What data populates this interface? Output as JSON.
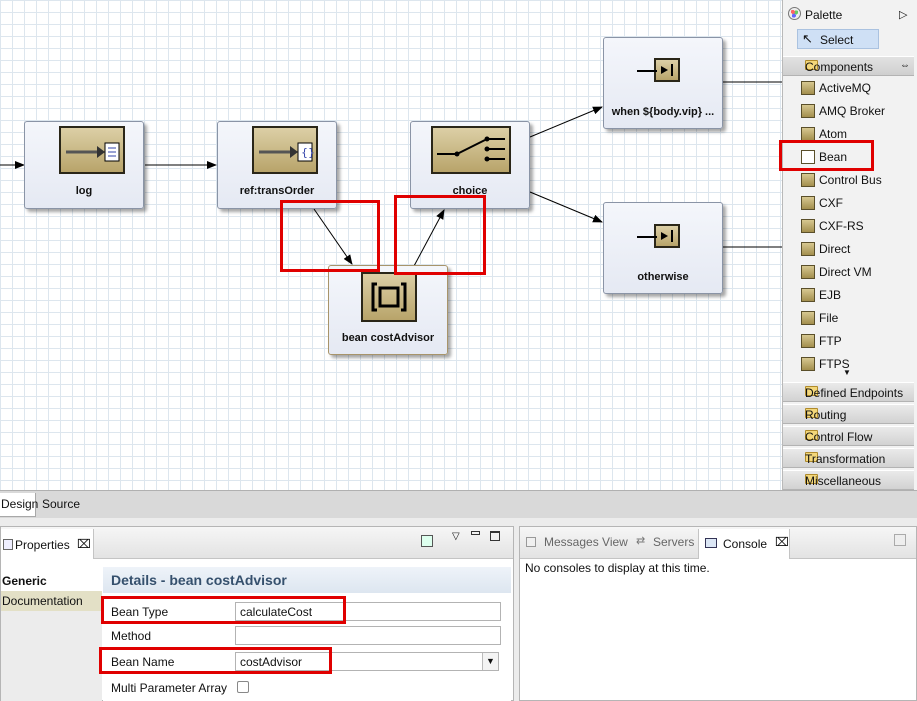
{
  "canvas": {
    "nodes": [
      {
        "id": "log",
        "label": "log"
      },
      {
        "id": "transorder",
        "label": "ref:transOrder"
      },
      {
        "id": "choice",
        "label": "choice"
      },
      {
        "id": "when",
        "label": "when ${body.vip} ..."
      },
      {
        "id": "otherwise",
        "label": "otherwise"
      },
      {
        "id": "bean",
        "label": "bean costAdvisor"
      }
    ]
  },
  "palette": {
    "title": "Palette",
    "select_label": "Select",
    "components_drawer": "Components",
    "items": [
      "ActiveMQ",
      "AMQ Broker",
      "Atom",
      "Bean",
      "Control Bus",
      "CXF",
      "CXF-RS",
      "Direct",
      "Direct VM",
      "EJB",
      "File",
      "FTP",
      "FTPS"
    ],
    "drawers": [
      "Defined Endpoints",
      "Routing",
      "Control Flow",
      "Transformation",
      "Miscellaneous"
    ]
  },
  "editor_tabs": [
    "Design",
    "Source"
  ],
  "properties": {
    "tab_label": "Properties",
    "side_tabs": [
      "Generic",
      "Documentation"
    ],
    "details_title": "Details - bean costAdvisor",
    "fields": {
      "bean_type_label": "Bean Type",
      "bean_type_value": "calculateCost",
      "method_label": "Method",
      "method_value": "",
      "bean_name_label": "Bean Name",
      "bean_name_value": "costAdvisor",
      "multi_param_label": "Multi Parameter Array"
    }
  },
  "console": {
    "tabs": [
      "Messages View",
      "Servers",
      "Console"
    ],
    "message": "No consoles to display at this time."
  },
  "colors": {
    "highlight": "#e00000",
    "details_title": "#35506d",
    "select_bg": "#cfe0f5"
  }
}
